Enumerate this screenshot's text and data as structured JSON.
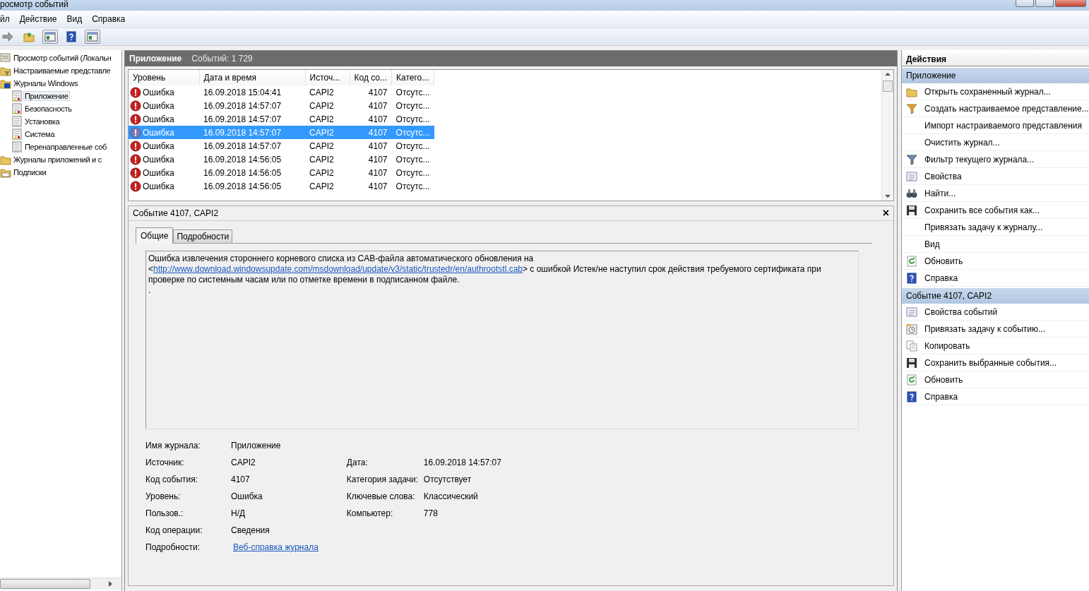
{
  "window": {
    "title": "росмотр событий"
  },
  "menu": [
    "йл",
    "Действие",
    "Вид",
    "Справка"
  ],
  "toolbar": [
    {
      "kind": "forward"
    },
    {
      "kind": "folder-up"
    },
    {
      "kind": "panel"
    },
    {
      "kind": "help"
    },
    {
      "kind": "panel"
    }
  ],
  "tree": [
    {
      "label": "Просмотр событий (Локальн",
      "kind": "viewer",
      "selected": false,
      "children": [
        {
          "label": "Настраиваемые представле",
          "kind": "folder-filter",
          "selected": false
        },
        {
          "label": "Журналы Windows",
          "kind": "folder-win",
          "selected": false,
          "children": [
            {
              "label": "Приложение",
              "kind": "log-warn",
              "selected": true
            },
            {
              "label": "Безопасность",
              "kind": "log-warn",
              "selected": false
            },
            {
              "label": "Установка",
              "kind": "log",
              "selected": false
            },
            {
              "label": "Система",
              "kind": "log-warn",
              "selected": false
            },
            {
              "label": "Перенаправленные соб",
              "kind": "log",
              "selected": false
            }
          ]
        },
        {
          "label": "Журналы приложений и с",
          "kind": "folder",
          "selected": false
        },
        {
          "label": "Подписки",
          "kind": "subscriptions",
          "selected": false
        }
      ]
    }
  ],
  "log_header": {
    "name": "Приложение",
    "count": "Событий: 1 729"
  },
  "table": {
    "columns": [
      "Уровень",
      "Дата и время",
      "Источ...",
      "Код со...",
      "Катего..."
    ],
    "rows": [
      {
        "level": "Ошибка",
        "datetime": "16.09.2018 15:04:41",
        "source": "CAPI2",
        "code": "4107",
        "category": "Отсутс...",
        "selected": false
      },
      {
        "level": "Ошибка",
        "datetime": "16.09.2018 14:57:07",
        "source": "CAPI2",
        "code": "4107",
        "category": "Отсутс...",
        "selected": false
      },
      {
        "level": "Ошибка",
        "datetime": "16.09.2018 14:57:07",
        "source": "CAPI2",
        "code": "4107",
        "category": "Отсутс...",
        "selected": false
      },
      {
        "level": "Ошибка",
        "datetime": "16.09.2018 14:57:07",
        "source": "CAPI2",
        "code": "4107",
        "category": "Отсутс...",
        "selected": true
      },
      {
        "level": "Ошибка",
        "datetime": "16.09.2018 14:57:07",
        "source": "CAPI2",
        "code": "4107",
        "category": "Отсутс...",
        "selected": false
      },
      {
        "level": "Ошибка",
        "datetime": "16.09.2018 14:56:05",
        "source": "CAPI2",
        "code": "4107",
        "category": "Отсутс...",
        "selected": false
      },
      {
        "level": "Ошибка",
        "datetime": "16.09.2018 14:56:05",
        "source": "CAPI2",
        "code": "4107",
        "category": "Отсутс...",
        "selected": false
      },
      {
        "level": "Ошибка",
        "datetime": "16.09.2018 14:56:05",
        "source": "CAPI2",
        "code": "4107",
        "category": "Отсутс...",
        "selected": false
      }
    ]
  },
  "detail": {
    "title": "Событие 4107, CAPI2",
    "close": "×",
    "tabs": [
      {
        "label": "Общие",
        "selected": true
      },
      {
        "label": "Подробности",
        "selected": false
      }
    ],
    "message": {
      "before": "Ошибка извлечения стороннего корневого списка из CAB-файла автоматического обновления на <",
      "link": "http://www.download.windowsupdate.com/msdownload/update/v3/static/trustedr/en/authrootstl.cab",
      "after": "> с ошибкой Истек/не наступил срок действия требуемого сертификата при проверке по системным часам или по отметке времени в подписанном файле.",
      "trailing": "."
    },
    "fields_left": [
      {
        "label": "Имя журнала:",
        "value": "Приложение"
      },
      {
        "label": "Источник:",
        "value": "CAPI2"
      },
      {
        "label": "Код события:",
        "value": "4107"
      },
      {
        "label": "Уровень:",
        "value": "Ошибка"
      },
      {
        "label": "Пользов.:",
        "value": "Н/Д"
      },
      {
        "label": "Код операции:",
        "value": "Сведения"
      },
      {
        "label": "Подробности:",
        "value": "Веб-справка журнала",
        "kind": "link"
      }
    ],
    "fields_right": [
      {
        "label": "Дата:",
        "value": "16.09.2018 14:57:07"
      },
      {
        "label": "Категория задачи:",
        "value": "Отсутствует"
      },
      {
        "label": "Ключевые слова:",
        "value": "Классический"
      },
      {
        "label": "Компьютер:",
        "value": "778"
      }
    ]
  },
  "actions": {
    "title": "Действия",
    "sections": [
      {
        "title": "Приложение",
        "items": [
          {
            "label": "Открыть сохраненный журнал...",
            "kind": "folder"
          },
          {
            "label": "Создать настраиваемое представление...",
            "kind": "filter-color"
          },
          {
            "label": "Импорт настраиваемого представления",
            "kind": "none"
          },
          {
            "label": "Очистить журнал...",
            "kind": "none"
          },
          {
            "label": "Фильтр текущего журнала...",
            "kind": "filter"
          },
          {
            "label": "Свойства",
            "kind": "properties"
          },
          {
            "label": "Найти...",
            "kind": "binoculars"
          },
          {
            "label": "Сохранить все события как...",
            "kind": "floppy"
          },
          {
            "label": "Привязать задачу к журналу...",
            "kind": "none"
          },
          {
            "label": "Вид",
            "kind": "none"
          },
          {
            "label": "Обновить",
            "kind": "refresh"
          },
          {
            "label": "Справка",
            "kind": "help"
          }
        ]
      },
      {
        "title": "Событие 4107, CAPI2",
        "items": [
          {
            "label": "Свойства событий",
            "kind": "properties"
          },
          {
            "label": "Привязать задачу к событию...",
            "kind": "task"
          },
          {
            "label": "Копировать",
            "kind": "copy"
          },
          {
            "label": "Сохранить выбранные события...",
            "kind": "floppy"
          },
          {
            "label": "Обновить",
            "kind": "refresh"
          },
          {
            "label": "Справка",
            "kind": "help"
          }
        ]
      }
    ]
  }
}
